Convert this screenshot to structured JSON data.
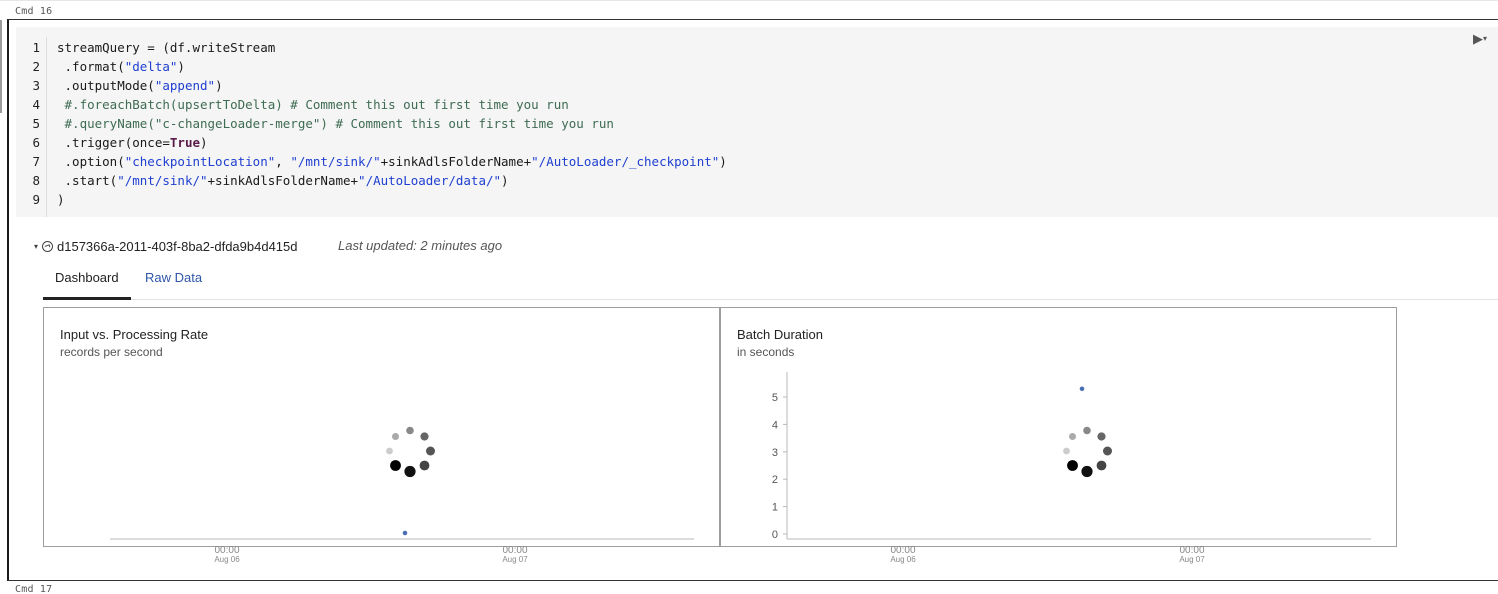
{
  "cells": {
    "top_label": "Cmd 16",
    "bottom_label": "Cmd 17"
  },
  "code": {
    "line_numbers": [
      "1",
      "2",
      "3",
      "4",
      "5",
      "6",
      "7",
      "8",
      "9"
    ],
    "lines": [
      "streamQuery = (df.writeStream",
      " .format(\"delta\")",
      " .outputMode(\"append\")",
      " #.foreachBatch(upsertToDelta) # Comment this out first time you run",
      " #.queryName(\"c-changeLoader-merge\") # Comment this out first time you run",
      " .trigger(once=True)",
      " .option(\"checkpointLocation\", \"/mnt/sink/\"+sinkAdlsFolderName+\"/AutoLoader/_checkpoint\")",
      " .start(\"/mnt/sink/\"+sinkAdlsFolderName+\"/AutoLoader/data/\")",
      ")"
    ]
  },
  "toolbar": {
    "run_icon": "play-icon",
    "run_glyph": "▶",
    "menu_glyph": "▾"
  },
  "stream": {
    "expand_glyph": "▾",
    "status_icon": "gauge-icon",
    "id": "d157366a-2011-403f-8ba2-dfda9b4d415d",
    "last_updated": "Last updated: 2 minutes ago"
  },
  "tabs": [
    {
      "label": "Dashboard",
      "active": true
    },
    {
      "label": "Raw Data",
      "active": false
    }
  ],
  "panels": {
    "input_rate": {
      "title": "Input vs. Processing Rate",
      "subtitle": "records per second",
      "x_ticks": [
        {
          "time": "00:00",
          "date": "Aug 06"
        },
        {
          "time": "00:00",
          "date": "Aug 07"
        }
      ]
    },
    "batch_duration": {
      "title": "Batch Duration",
      "subtitle": "in seconds",
      "y_ticks": [
        "5",
        "4",
        "3",
        "2",
        "1",
        "0"
      ],
      "x_ticks": [
        {
          "time": "00:00",
          "date": "Aug 06"
        },
        {
          "time": "00:00",
          "date": "Aug 07"
        }
      ]
    }
  },
  "chart_data": [
    {
      "type": "scatter",
      "title": "Input vs. Processing Rate",
      "subtitle": "records per second",
      "x_ticks": [
        "00:00 Aug 06",
        "00:00 Aug 07"
      ],
      "series": [
        {
          "values": [
            0
          ]
        }
      ],
      "loading": true
    },
    {
      "type": "scatter",
      "title": "Batch Duration",
      "subtitle": "in seconds",
      "y_ticks": [
        0,
        1,
        2,
        3,
        4,
        5
      ],
      "ylim": [
        0,
        5.5
      ],
      "x_ticks": [
        "00:00 Aug 06",
        "00:00 Aug 07"
      ],
      "series": [
        {
          "values": [
            5.3
          ]
        }
      ],
      "loading": true
    }
  ],
  "colors": {
    "point": "#4a6fb5",
    "link": "#2f56a8",
    "string": "#1f3fd1",
    "comment": "#3e6b53"
  }
}
